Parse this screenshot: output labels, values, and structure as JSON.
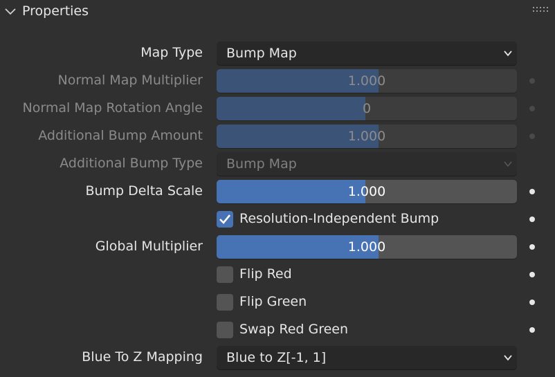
{
  "panel": {
    "title": "Properties",
    "collapse_icon": "chevron-down-icon",
    "drag_icon": "grip-icon"
  },
  "rows": {
    "map_type": {
      "label": "Map Type",
      "value": "Bump Map"
    },
    "normal_map_multiplier": {
      "label": "Normal Map Multiplier",
      "value": "1.000",
      "fill_fraction": 0.54
    },
    "normal_map_rotation": {
      "label": "Normal Map Rotation Angle",
      "value": "0",
      "fill_fraction": 0.495
    },
    "additional_bump_amount": {
      "label": "Additional Bump Amount",
      "value": "1.000",
      "fill_fraction": 0.54
    },
    "additional_bump_type": {
      "label": "Additional Bump Type",
      "value": "Bump Map"
    },
    "bump_delta_scale": {
      "label": "Bump Delta Scale",
      "value": "1.000",
      "fill_fraction": 0.495
    },
    "resolution_independent_bump": {
      "label": "Resolution-Independent Bump",
      "checked": true
    },
    "global_multiplier": {
      "label": "Global Multiplier",
      "value": "1.000",
      "fill_fraction": 0.54
    },
    "flip_red": {
      "label": "Flip Red",
      "checked": false
    },
    "flip_green": {
      "label": "Flip Green",
      "checked": false
    },
    "swap_red_green": {
      "label": "Swap Red Green",
      "checked": false
    },
    "blue_to_z_mapping": {
      "label": "Blue To Z Mapping",
      "value": "Blue to Z[-1, 1]"
    }
  },
  "colors": {
    "background": "#303030",
    "accent": "#4772b3",
    "field": "#545454",
    "dropdown": "#282828"
  }
}
